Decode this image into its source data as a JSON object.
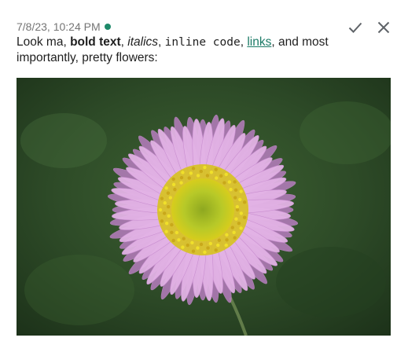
{
  "message": {
    "timestamp": "7/8/23, 10:24 PM",
    "status_color": "#1e8a6a",
    "parts": {
      "t1": "Look ma, ",
      "bold": "bold text",
      "t2": ", ",
      "italic": "italics",
      "t3": ", ",
      "code": "inline code",
      "t4": ", ",
      "link": "links",
      "link_color": "#1b7a66",
      "t5": ", and most importantly, pretty flowers:"
    }
  },
  "actions": {
    "confirm_icon": "check-icon",
    "close_icon": "close-icon"
  },
  "image": {
    "subject": "pink daisy flower",
    "colors": {
      "background": "#2f4d2a",
      "petal": "#e3b3e6",
      "petal_edge": "#b77dbf",
      "center": "#b5c92a",
      "stamen": "#e4d218"
    }
  }
}
